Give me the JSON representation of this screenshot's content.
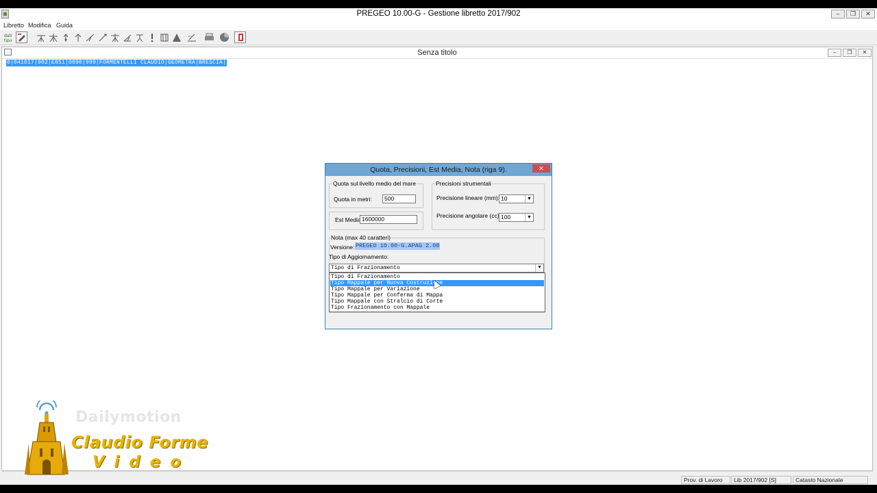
{
  "app": {
    "title": "PREGEO 10.00-G - Gestione libretto 2017/902",
    "window_buttons": {
      "minimize": "‒",
      "restore": "❐",
      "close": "✕"
    }
  },
  "menu": [
    "Libretto",
    "Modifica",
    "Guida"
  ],
  "toolbar": {
    "tools": [
      {
        "icon": "dati-tipo-icon"
      },
      {
        "icon": "pen-icon"
      },
      {
        "icon": "station-icon"
      },
      {
        "icon": "station-multi-icon"
      },
      {
        "icon": "point-up-icon"
      },
      {
        "icon": "arrow-up-icon"
      },
      {
        "icon": "alignment-icon"
      },
      {
        "icon": "diagonal-icon"
      },
      {
        "icon": "station-grid-icon"
      },
      {
        "icon": "angle-icon"
      },
      {
        "icon": "tripod-icon"
      },
      {
        "icon": "exclamation-icon"
      },
      {
        "icon": "frame-icon"
      },
      {
        "icon": "triangle-icon"
      },
      {
        "icon": "edit-icon"
      },
      {
        "icon": "printer-icon"
      },
      {
        "icon": "globe-icon"
      },
      {
        "icon": "exit-icon"
      }
    ]
  },
  "document": {
    "title": "Senza titolo",
    "line": "0|041017|902|E851|0090|999|FORMENTELLI CLAUDIO|GEOMETRA|BRESCIA|"
  },
  "status": {
    "cells": [
      "Prov. di Lavoro BS",
      "Lib 2017/902 [S]",
      "Catasto Nazionale"
    ]
  },
  "dialog": {
    "title": "Quota, Precisioni, Est Media, Nota  (riga 9).",
    "close": "✕",
    "quota_group": "Quota sul livello medio del mare",
    "quota_label": "Quota in metri:",
    "quota_value": "500",
    "est_label": "Est Media:",
    "est_value": "1600000",
    "prec_group": "Precisioni strumentali",
    "prec_lin_label": "Precisione lineare (mm):",
    "prec_lin_value": "10",
    "prec_ang_label": "Precisione  angolare (cc):",
    "prec_ang_value": "100",
    "nota_group": "Nota (max 40 caratteri)",
    "versione_label": "Versione:",
    "versione_value": "PREGEO 10.00-G.APAG 2.08",
    "tipo_label": "Tipo di Aggiornamento:",
    "tipo_selected": "Tipo di Frazionamento",
    "tipo_options": [
      "Tipo di Frazionamento",
      "Tipo Mappale per Nuova Costruzione",
      "Tipo Mappale per Variazione",
      "Tipo Mappale per Conferma di Mappa",
      "Tipo Mappale con Stralcio di Corte",
      "Tipo Frazionamento con Mappale"
    ],
    "highlighted_option": 1
  },
  "watermark": {
    "brand": "Dailymotion",
    "name": "Claudio Forme",
    "sub": "Video"
  }
}
